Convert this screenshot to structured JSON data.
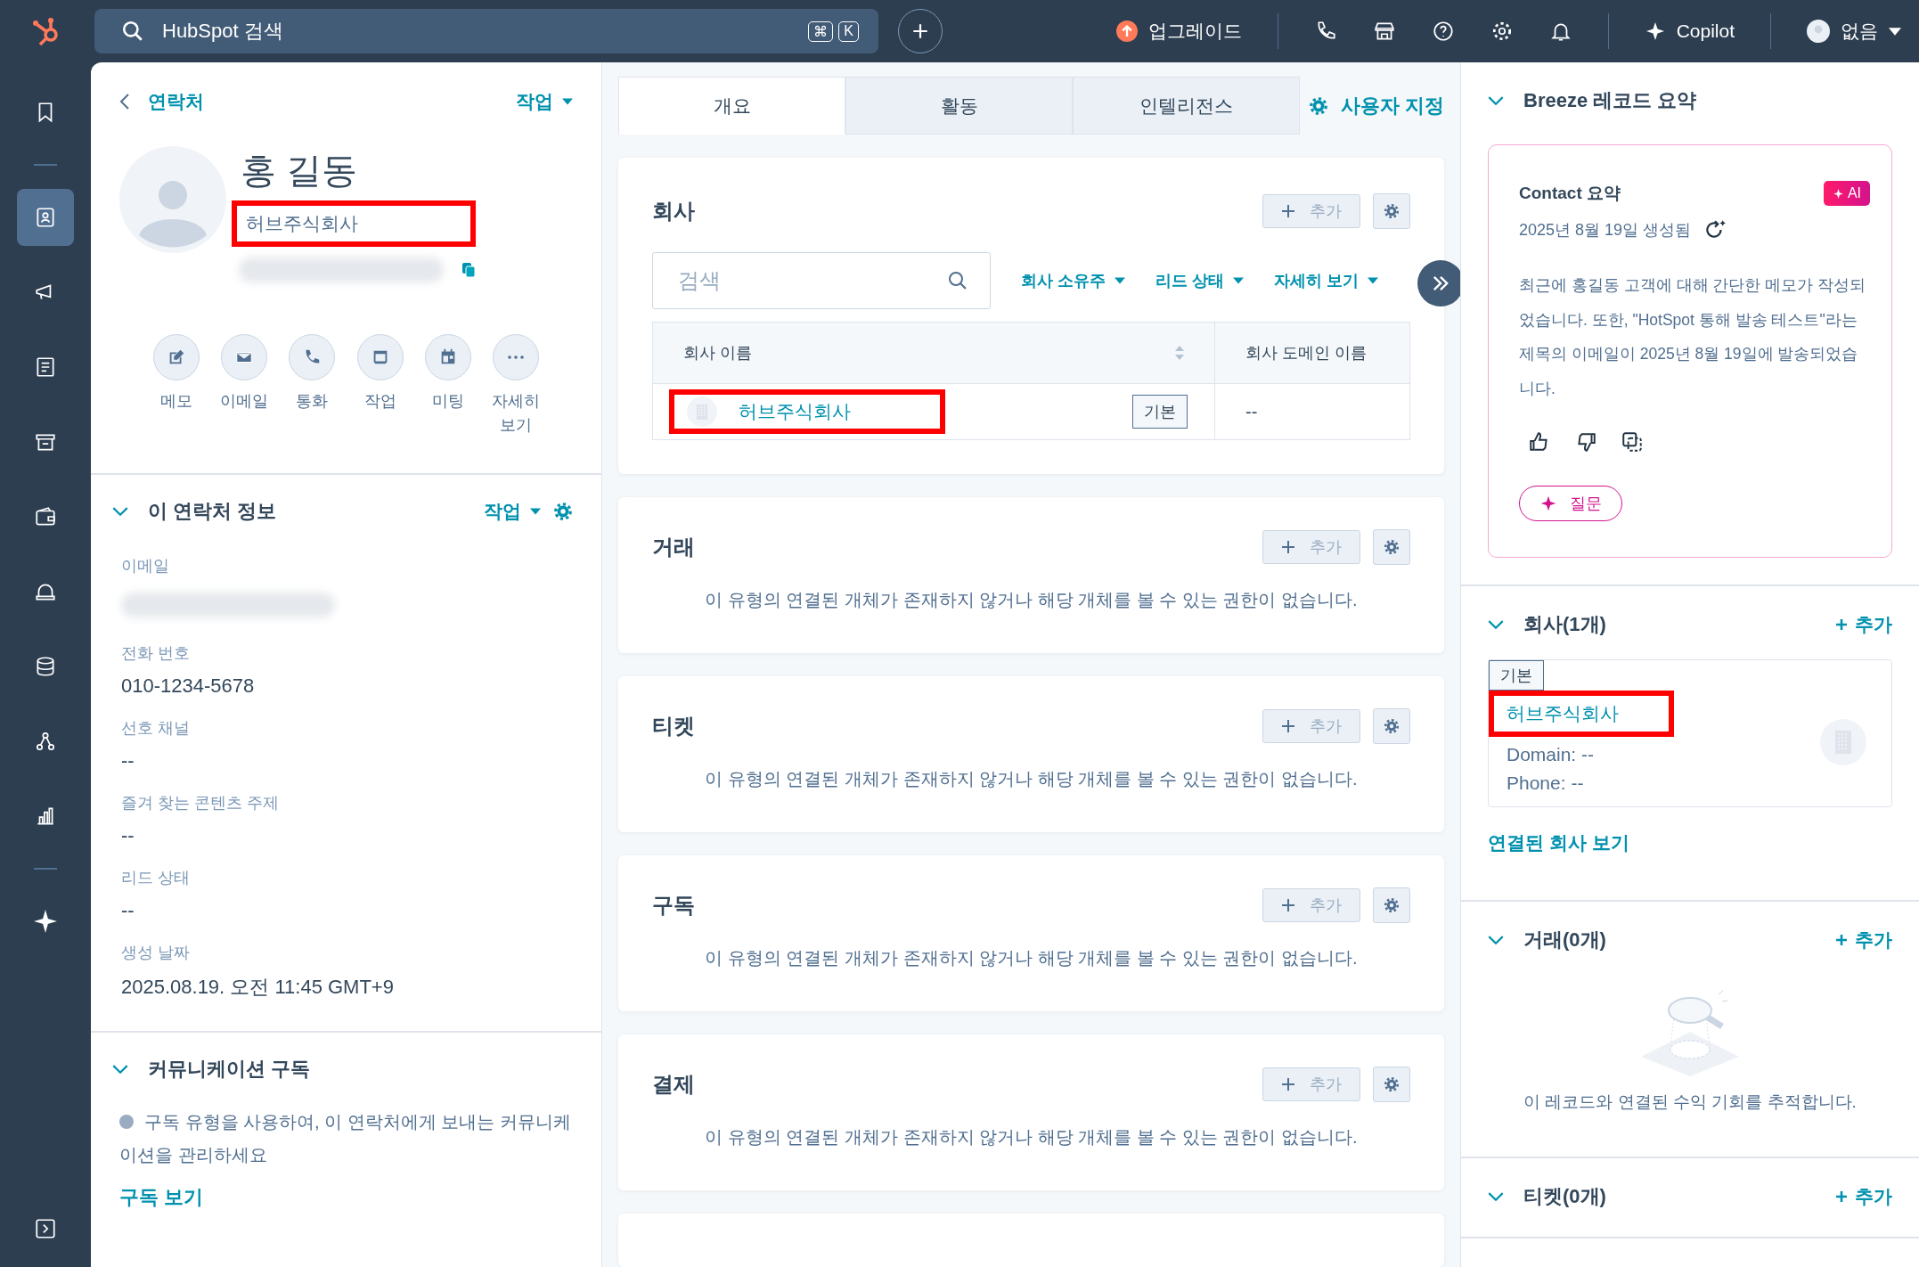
{
  "topbar": {
    "search_placeholder": "HubSpot 검색",
    "shortcut_keys": [
      "⌘",
      "K"
    ],
    "upgrade": "업그레이드",
    "copilot": "Copilot",
    "account": "없음"
  },
  "sidebar": {
    "items": [
      {
        "kind": "bookmark",
        "selected": false
      },
      {
        "kind": "contacts",
        "selected": true
      },
      {
        "kind": "megaphone",
        "selected": false
      },
      {
        "kind": "document",
        "selected": false
      },
      {
        "kind": "store",
        "selected": false
      },
      {
        "kind": "wallet",
        "selected": false
      },
      {
        "kind": "bell",
        "selected": false
      },
      {
        "kind": "database",
        "selected": false
      },
      {
        "kind": "network",
        "selected": false
      },
      {
        "kind": "chart",
        "selected": false
      },
      {
        "kind": "sparkle",
        "selected": false
      }
    ]
  },
  "contact": {
    "back_link": "연락처",
    "actions_menu": "작업",
    "name": "홍 길동",
    "company": "허브주식회사",
    "company_highlighted": true,
    "actions": [
      {
        "kind": "note",
        "label": "메모"
      },
      {
        "kind": "email",
        "label": "이메일"
      },
      {
        "kind": "call",
        "label": "통화"
      },
      {
        "kind": "task",
        "label": "작업"
      },
      {
        "kind": "meeting",
        "label": "미팅"
      },
      {
        "kind": "more",
        "label": "자세히 보기"
      }
    ]
  },
  "about": {
    "title": "이 연락처 정보",
    "actions_menu": "작업",
    "expanded": true,
    "fields": [
      {
        "label": "이메일",
        "redacted": true
      },
      {
        "label": "전화 번호",
        "value": "010-1234-5678"
      },
      {
        "label": "선호 채널",
        "value": "--"
      },
      {
        "label": "즐겨 찾는 콘텐츠 주제",
        "value": "--"
      },
      {
        "label": "리드 상태",
        "value": "--"
      },
      {
        "label": "생성 날짜",
        "value": "2025.08.19. 오전 11:45 GMT+9"
      }
    ]
  },
  "subscriptions": {
    "title": "커뮤니케이션 구독",
    "expanded": true,
    "text": "구독 유형을 사용하여, 이 연락처에게 보내는 커뮤니케이션을 관리하세요",
    "link": "구독 보기"
  },
  "tabs": [
    {
      "label": "개요",
      "selected": true
    },
    {
      "label": "활동",
      "selected": false
    },
    {
      "label": "인텔리전스",
      "selected": false
    }
  ],
  "customize": "사용자 지정",
  "cards": [
    {
      "kind": "table",
      "title": "회사",
      "add": "추가",
      "search_placeholder": "검색",
      "filters": [
        "회사 소유주",
        "리드 상태",
        "자세히 보기"
      ],
      "columns": [
        "회사 이름",
        "회사 도메인 이름"
      ],
      "rows": [
        {
          "name": "허브주식회사",
          "badge": "기본",
          "domain": "--",
          "highlighted": true
        }
      ]
    },
    {
      "kind": "empty",
      "title": "거래",
      "add": "추가",
      "text": "이 유형의 연결된 개체가 존재하지 않거나 해당 개체를 볼 수 있는 권한이 없습니다."
    },
    {
      "kind": "empty",
      "title": "티켓",
      "add": "추가",
      "text": "이 유형의 연결된 개체가 존재하지 않거나 해당 개체를 볼 수 있는 권한이 없습니다."
    },
    {
      "kind": "empty",
      "title": "구독",
      "add": "추가",
      "text": "이 유형의 연결된 개체가 존재하지 않거나 해당 개체를 볼 수 있는 권한이 없습니다."
    },
    {
      "kind": "empty",
      "title": "결제",
      "add": "추가",
      "text": "이 유형의 연결된 개체가 존재하지 않거나 해당 개체를 볼 수 있는 권한이 없습니다."
    }
  ],
  "right": {
    "breeze": {
      "title": "Breeze 레코드 요약",
      "expanded": true,
      "summary_title": "Contact 요약",
      "ai_badge": "AI",
      "generated": "2025년 8월 19일 생성됨",
      "text": "최근에 홍길동 고객에 대해 간단한 메모가 작성되었습니다. 또한, \"HotSpot 통해 발송 테스트\"라는 제목의 이메일이 2025년 8월 19일에 발송되었습니다.",
      "ask": "질문"
    },
    "companies": {
      "title": "회사(1개)",
      "add": "추가",
      "expanded": true,
      "badge": "기본",
      "name": "허브주식회사",
      "highlighted": true,
      "domain": "Domain: --",
      "phone": "Phone: --",
      "link": "연결된 회사 보기"
    },
    "deals": {
      "title": "거래(0개)",
      "add": "추가",
      "expanded": true,
      "empty_text": "이 레코드와 연결된 수익 기회를 추적합니다."
    },
    "tickets": {
      "title": "티켓(0개)",
      "add": "추가",
      "expanded": true
    }
  }
}
